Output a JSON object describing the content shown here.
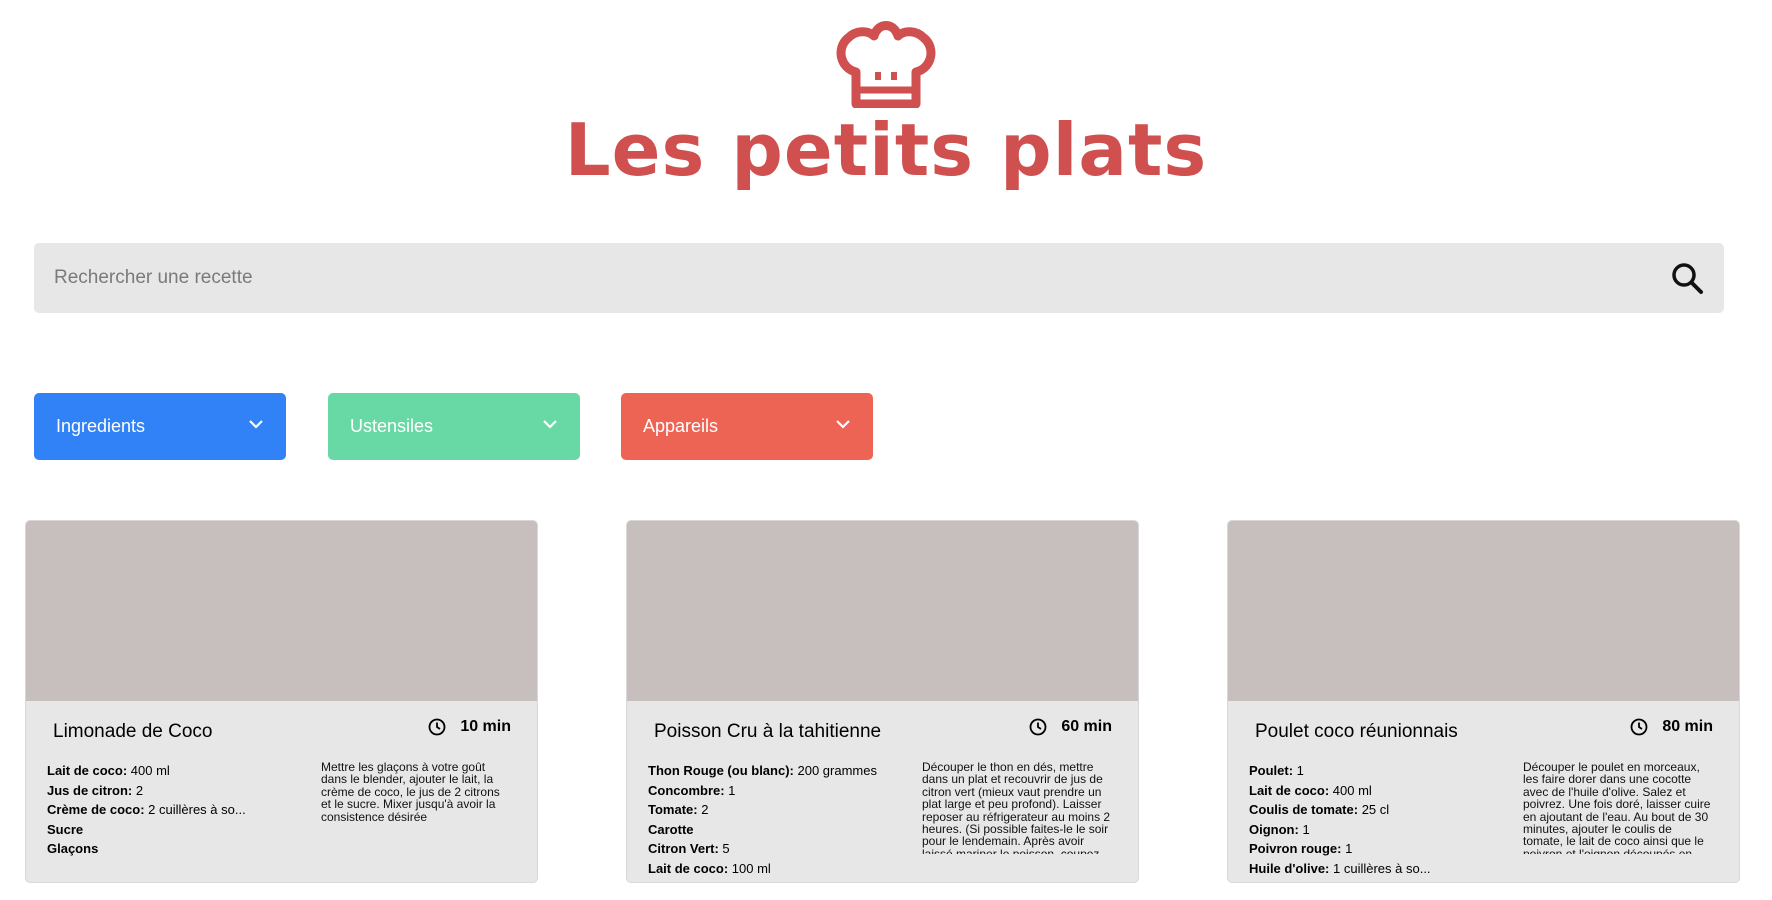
{
  "header": {
    "title": "Les petits plats"
  },
  "search": {
    "placeholder": "Rechercher une recette"
  },
  "filters": [
    {
      "label": "Ingredients",
      "color": "#3282F7"
    },
    {
      "label": "Ustensiles",
      "color": "#68D9A4"
    },
    {
      "label": "Appareils",
      "color": "#ED6454"
    }
  ],
  "recipes": [
    {
      "name": "Limonade de Coco",
      "time": "10 min",
      "ingredients": [
        {
          "name": "Lait de coco:",
          "qty": " 400 ml"
        },
        {
          "name": "Jus de citron:",
          "qty": " 2"
        },
        {
          "name": "Crème de coco:",
          "qty": " 2 cuillères à so..."
        },
        {
          "name": "Sucre",
          "qty": ""
        },
        {
          "name": "Glaçons",
          "qty": ""
        }
      ],
      "description": "Mettre les glaçons à votre goût dans le blender, ajouter le lait, la crème de coco, le jus de 2 citrons et le sucre. Mixer jusqu'à avoir la consistence désirée"
    },
    {
      "name": "Poisson Cru à la tahitienne",
      "time": "60 min",
      "ingredients": [
        {
          "name": "Thon Rouge (ou blanc):",
          "qty": " 200 grammes"
        },
        {
          "name": "Concombre:",
          "qty": " 1"
        },
        {
          "name": "Tomate:",
          "qty": " 2"
        },
        {
          "name": "Carotte",
          "qty": ""
        },
        {
          "name": "Citron Vert:",
          "qty": " 5"
        },
        {
          "name": "Lait de coco:",
          "qty": " 100 ml"
        }
      ],
      "description": "Découper le thon en dés, mettre dans un plat et recouvrir de jus de citron vert (mieux vaut prendre un plat large et peu profond). Laisser reposer au réfrigerateur au moins 2 heures. (Si possible faites-le le soir pour le lendemain. Après avoir laissé mariner le poisson, coupez..."
    },
    {
      "name": "Poulet coco réunionnais",
      "time": "80 min",
      "ingredients": [
        {
          "name": "Poulet:",
          "qty": " 1"
        },
        {
          "name": "Lait de coco:",
          "qty": " 400 ml"
        },
        {
          "name": "Coulis de tomate:",
          "qty": " 25 cl"
        },
        {
          "name": "Oignon:",
          "qty": " 1"
        },
        {
          "name": "Poivron rouge:",
          "qty": " 1"
        },
        {
          "name": "Huile d'olive:",
          "qty": " 1 cuillères à so..."
        }
      ],
      "description": "Découper le poulet en morceaux, les faire dorer dans une cocotte avec de l'huile d'olive. Salez et poivrez. Une fois doré, laisser cuire en ajoutant de l'eau. Au bout de 30 minutes, ajouter le coulis de tomate, le lait de coco ainsi que le poivron et l'oignon découpés en..."
    }
  ]
}
